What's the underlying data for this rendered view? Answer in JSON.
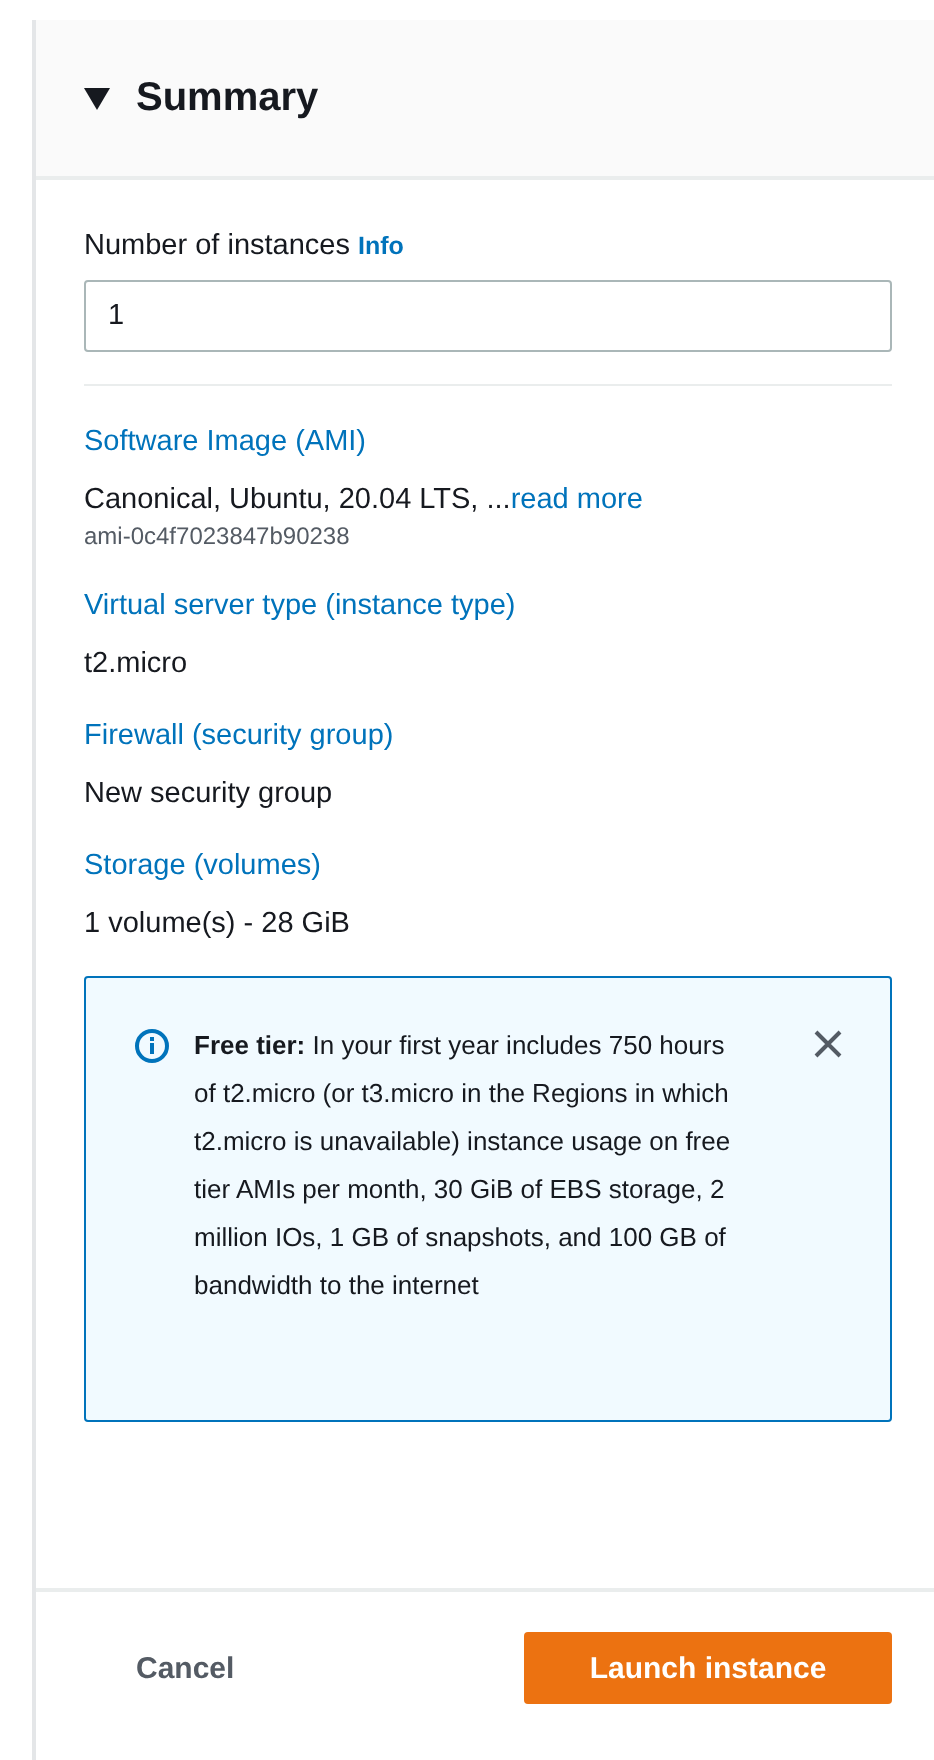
{
  "header": {
    "title": "Summary",
    "expanded": true
  },
  "instances": {
    "label": "Number of instances",
    "info_link": "Info",
    "value": "1"
  },
  "details": [
    {
      "label": "Software Image (AMI)",
      "value": "Canonical, Ubuntu, 20.04 LTS, ...",
      "link": "read more",
      "sub": "ami-0c4f7023847b90238"
    },
    {
      "label": "Virtual server type (instance type)",
      "value": "t2.micro"
    },
    {
      "label": "Firewall (security group)",
      "value": "New security group"
    },
    {
      "label": "Storage (volumes)",
      "value": "1 volume(s) - 28 GiB"
    }
  ],
  "alert": {
    "text": "**Free tier:** In your first year includes 750 hours of t2.micro (or t3.micro in the Regions in which t2.micro is unavailable) instance usage on free tier AMIs per month, 30 GiB of EBS storage, 2 million IOs, 1 GB of snapshots, and 100 GB of bandwidth to the internet"
  },
  "footer": {
    "cancel": "Cancel",
    "primary": "Launch instance"
  }
}
